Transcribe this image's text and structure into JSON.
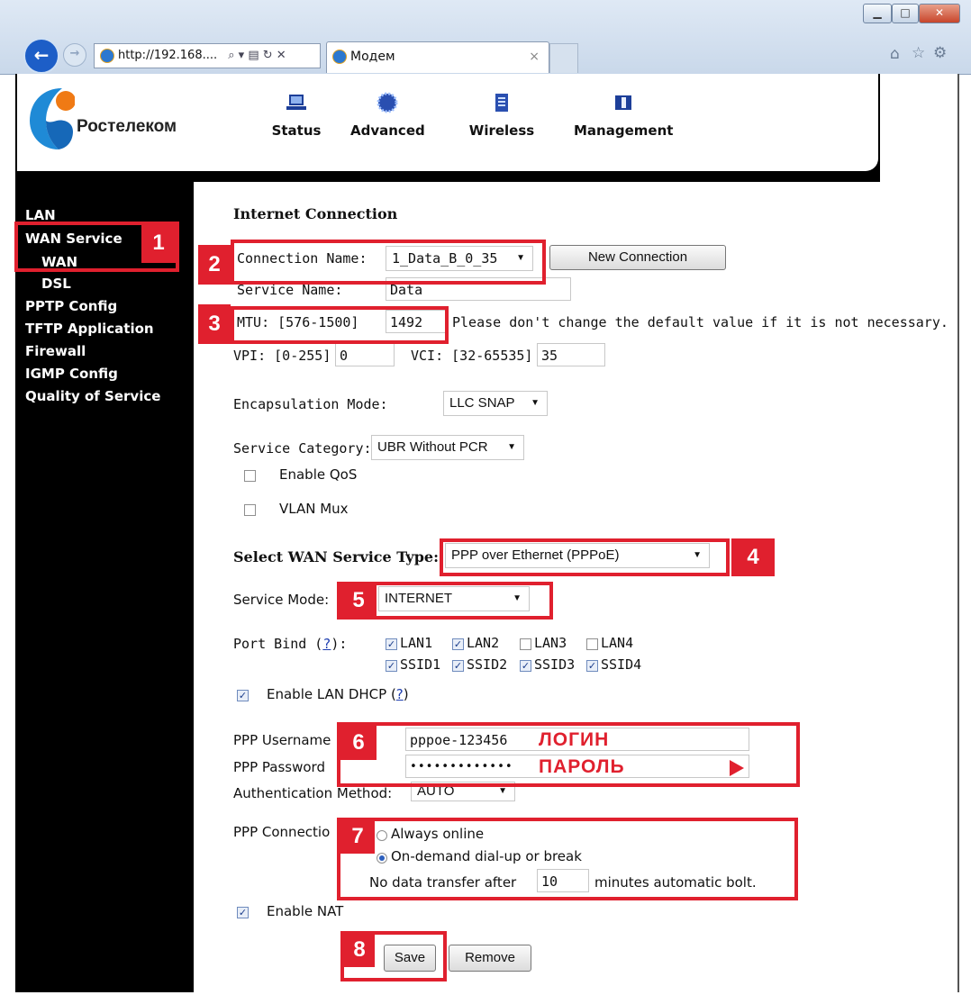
{
  "browser": {
    "address": "http://192.168....",
    "tab_title": "Модем",
    "tab_close": "×",
    "addr_controls": "⌕ ▾ ▤ ↻ ✕"
  },
  "brand": {
    "name": "Ростелеком"
  },
  "topnav": {
    "status": "Status",
    "advanced": "Advanced",
    "wireless": "Wireless",
    "management": "Management"
  },
  "sidebar": {
    "lan": "LAN",
    "wan_service": "WAN Service",
    "wan": "WAN",
    "dsl": "DSL",
    "pptp": "PPTP Config",
    "tftp": "TFTP Application",
    "firewall": "Firewall",
    "igmp": "IGMP Config",
    "qos": "Quality of Service"
  },
  "form": {
    "section_title": "Internet Connection",
    "connection_name_label": "Connection Name:",
    "connection_name_value": "1_Data_B_0_35",
    "new_connection_button": "New Connection",
    "service_name_label": "Service Name:",
    "service_name_value": "Data",
    "mtu_label": "MTU: [576-1500]",
    "mtu_value": "1492",
    "mtu_hint": "Please don't change the default value if it is not necessary.",
    "vpi_label": "VPI: [0-255]",
    "vpi_value": "0",
    "vci_label": "VCI: [32-65535]",
    "vci_value": "35",
    "encap_label": "Encapsulation Mode:",
    "encap_value": "LLC SNAP",
    "service_category_label": "Service Category:",
    "service_category_value": "UBR Without PCR",
    "enable_qos": "Enable QoS",
    "vlan_mux": "VLAN Mux",
    "wan_type_label": "Select WAN Service Type:",
    "wan_type_value": "PPP over Ethernet (PPPoE)",
    "service_mode_label": "Service Mode:",
    "service_mode_value": "INTERNET",
    "port_bind_label": "Port Bind",
    "help": "?",
    "ports": {
      "lan1": "LAN1",
      "lan2": "LAN2",
      "lan3": "LAN3",
      "lan4": "LAN4",
      "ssid1": "SSID1",
      "ssid2": "SSID2",
      "ssid3": "SSID3",
      "ssid4": "SSID4"
    },
    "enable_lan_dhcp": "Enable LAN DHCP",
    "ppp_username_label": "PPP Username",
    "ppp_username_value": "pppoe-123456",
    "ppp_password_label": "PPP Password",
    "ppp_password_value": "•••••••••••••",
    "auth_method_label": "Authentication Method:",
    "auth_method_value": "AUTO",
    "ppp_connection_label": "PPP Connectio",
    "always_online": "Always online",
    "on_demand": "On-demand dial-up or break",
    "no_data_before": "No data transfer after",
    "no_data_value": "10",
    "no_data_after": "minutes automatic bolt.",
    "enable_nat": "Enable NAT",
    "save_button": "Save",
    "remove_button": "Remove"
  },
  "annotations": {
    "n1": "1",
    "n2": "2",
    "n3": "3",
    "n4": "4",
    "n5": "5",
    "n6": "6",
    "n7": "7",
    "n8": "8",
    "login": "ЛОГИН",
    "password": "ПАРОЛЬ",
    "accent_color": "#e0202e"
  }
}
